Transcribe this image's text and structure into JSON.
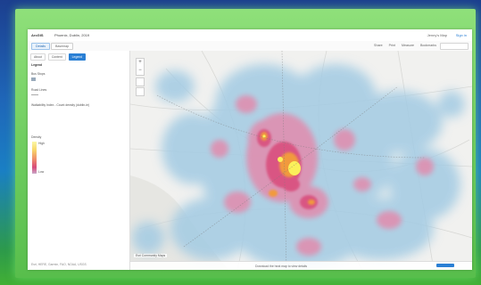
{
  "app": {
    "brand": "ArcGIS",
    "title": "Phoenix, Dublin, 2019",
    "user": "Jenny's Map",
    "sign_in": "Sign in"
  },
  "toolbar": {
    "tabs": [
      "Details",
      "Basemap"
    ],
    "tools": [
      "Share",
      "Print",
      "Measure",
      "Bookmarks"
    ]
  },
  "sidebar": {
    "tabs": [
      "About",
      "Content",
      "Legend"
    ],
    "heading": "Legend",
    "layer1": "Bus Stops",
    "layer2": "Road Lines",
    "layer3": "Walkability Index - Count density (dublin-ie)",
    "ramp_title": "Density",
    "ramp_high": "High",
    "ramp_low": "Low",
    "footer": "Esri, HERE, Garmin, FAO, NOAA, USGS"
  },
  "map": {
    "attribution": "Esri Community Maps",
    "footer_text": "Download the heat map to view details",
    "heat_colors": {
      "halo": "#a3cbe3",
      "pink": "#df8fb0",
      "magenta": "#d94f7e",
      "orange": "#f19a3e",
      "yellow": "#fbf05a"
    }
  },
  "colors": {
    "accent": "#2a7fd4",
    "frame_glow": "#6fcd60",
    "bg_top": "#1c3f8f",
    "bg_bottom": "#42b035"
  }
}
